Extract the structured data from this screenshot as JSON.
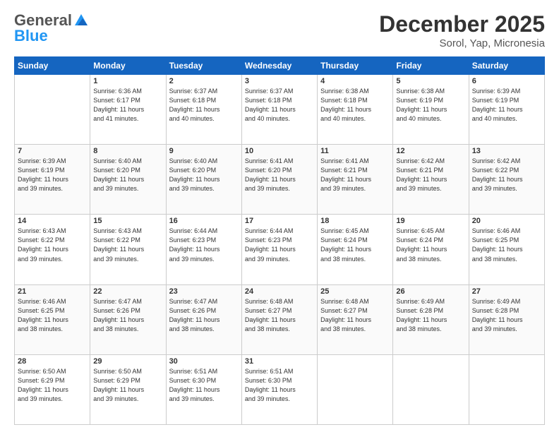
{
  "header": {
    "logo_general": "General",
    "logo_blue": "Blue",
    "month_title": "December 2025",
    "location": "Sorol, Yap, Micronesia"
  },
  "weekdays": [
    "Sunday",
    "Monday",
    "Tuesday",
    "Wednesday",
    "Thursday",
    "Friday",
    "Saturday"
  ],
  "weeks": [
    [
      {
        "day": "",
        "info": ""
      },
      {
        "day": "1",
        "info": "Sunrise: 6:36 AM\nSunset: 6:17 PM\nDaylight: 11 hours\nand 41 minutes."
      },
      {
        "day": "2",
        "info": "Sunrise: 6:37 AM\nSunset: 6:18 PM\nDaylight: 11 hours\nand 40 minutes."
      },
      {
        "day": "3",
        "info": "Sunrise: 6:37 AM\nSunset: 6:18 PM\nDaylight: 11 hours\nand 40 minutes."
      },
      {
        "day": "4",
        "info": "Sunrise: 6:38 AM\nSunset: 6:18 PM\nDaylight: 11 hours\nand 40 minutes."
      },
      {
        "day": "5",
        "info": "Sunrise: 6:38 AM\nSunset: 6:19 PM\nDaylight: 11 hours\nand 40 minutes."
      },
      {
        "day": "6",
        "info": "Sunrise: 6:39 AM\nSunset: 6:19 PM\nDaylight: 11 hours\nand 40 minutes."
      }
    ],
    [
      {
        "day": "7",
        "info": "Sunrise: 6:39 AM\nSunset: 6:19 PM\nDaylight: 11 hours\nand 39 minutes."
      },
      {
        "day": "8",
        "info": "Sunrise: 6:40 AM\nSunset: 6:20 PM\nDaylight: 11 hours\nand 39 minutes."
      },
      {
        "day": "9",
        "info": "Sunrise: 6:40 AM\nSunset: 6:20 PM\nDaylight: 11 hours\nand 39 minutes."
      },
      {
        "day": "10",
        "info": "Sunrise: 6:41 AM\nSunset: 6:20 PM\nDaylight: 11 hours\nand 39 minutes."
      },
      {
        "day": "11",
        "info": "Sunrise: 6:41 AM\nSunset: 6:21 PM\nDaylight: 11 hours\nand 39 minutes."
      },
      {
        "day": "12",
        "info": "Sunrise: 6:42 AM\nSunset: 6:21 PM\nDaylight: 11 hours\nand 39 minutes."
      },
      {
        "day": "13",
        "info": "Sunrise: 6:42 AM\nSunset: 6:22 PM\nDaylight: 11 hours\nand 39 minutes."
      }
    ],
    [
      {
        "day": "14",
        "info": "Sunrise: 6:43 AM\nSunset: 6:22 PM\nDaylight: 11 hours\nand 39 minutes."
      },
      {
        "day": "15",
        "info": "Sunrise: 6:43 AM\nSunset: 6:22 PM\nDaylight: 11 hours\nand 39 minutes."
      },
      {
        "day": "16",
        "info": "Sunrise: 6:44 AM\nSunset: 6:23 PM\nDaylight: 11 hours\nand 39 minutes."
      },
      {
        "day": "17",
        "info": "Sunrise: 6:44 AM\nSunset: 6:23 PM\nDaylight: 11 hours\nand 39 minutes."
      },
      {
        "day": "18",
        "info": "Sunrise: 6:45 AM\nSunset: 6:24 PM\nDaylight: 11 hours\nand 38 minutes."
      },
      {
        "day": "19",
        "info": "Sunrise: 6:45 AM\nSunset: 6:24 PM\nDaylight: 11 hours\nand 38 minutes."
      },
      {
        "day": "20",
        "info": "Sunrise: 6:46 AM\nSunset: 6:25 PM\nDaylight: 11 hours\nand 38 minutes."
      }
    ],
    [
      {
        "day": "21",
        "info": "Sunrise: 6:46 AM\nSunset: 6:25 PM\nDaylight: 11 hours\nand 38 minutes."
      },
      {
        "day": "22",
        "info": "Sunrise: 6:47 AM\nSunset: 6:26 PM\nDaylight: 11 hours\nand 38 minutes."
      },
      {
        "day": "23",
        "info": "Sunrise: 6:47 AM\nSunset: 6:26 PM\nDaylight: 11 hours\nand 38 minutes."
      },
      {
        "day": "24",
        "info": "Sunrise: 6:48 AM\nSunset: 6:27 PM\nDaylight: 11 hours\nand 38 minutes."
      },
      {
        "day": "25",
        "info": "Sunrise: 6:48 AM\nSunset: 6:27 PM\nDaylight: 11 hours\nand 38 minutes."
      },
      {
        "day": "26",
        "info": "Sunrise: 6:49 AM\nSunset: 6:28 PM\nDaylight: 11 hours\nand 38 minutes."
      },
      {
        "day": "27",
        "info": "Sunrise: 6:49 AM\nSunset: 6:28 PM\nDaylight: 11 hours\nand 39 minutes."
      }
    ],
    [
      {
        "day": "28",
        "info": "Sunrise: 6:50 AM\nSunset: 6:29 PM\nDaylight: 11 hours\nand 39 minutes."
      },
      {
        "day": "29",
        "info": "Sunrise: 6:50 AM\nSunset: 6:29 PM\nDaylight: 11 hours\nand 39 minutes."
      },
      {
        "day": "30",
        "info": "Sunrise: 6:51 AM\nSunset: 6:30 PM\nDaylight: 11 hours\nand 39 minutes."
      },
      {
        "day": "31",
        "info": "Sunrise: 6:51 AM\nSunset: 6:30 PM\nDaylight: 11 hours\nand 39 minutes."
      },
      {
        "day": "",
        "info": ""
      },
      {
        "day": "",
        "info": ""
      },
      {
        "day": "",
        "info": ""
      }
    ]
  ]
}
